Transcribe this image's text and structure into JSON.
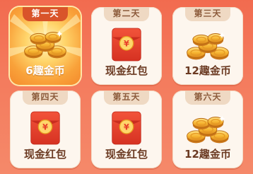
{
  "days": [
    {
      "tab": "第一天",
      "reward": "6趣金币",
      "icon": "coins-icon",
      "active": true
    },
    {
      "tab": "第二天",
      "reward": "现金红包",
      "icon": "red-envelope-icon",
      "active": false
    },
    {
      "tab": "第三天",
      "reward": "12趣金币",
      "icon": "coins-icon",
      "active": false
    },
    {
      "tab": "第四天",
      "reward": "现金红包",
      "icon": "red-envelope-icon",
      "active": false
    },
    {
      "tab": "第五天",
      "reward": "现金红包",
      "icon": "red-envelope-icon",
      "active": false
    },
    {
      "tab": "第六天",
      "reward": "12趣金币",
      "icon": "coins-icon",
      "active": false
    }
  ],
  "colors": {
    "active_tab": "#d9542a",
    "card_bg": "#fdf6ee",
    "envelope": "#e8402a",
    "coin": "#f7b733"
  }
}
